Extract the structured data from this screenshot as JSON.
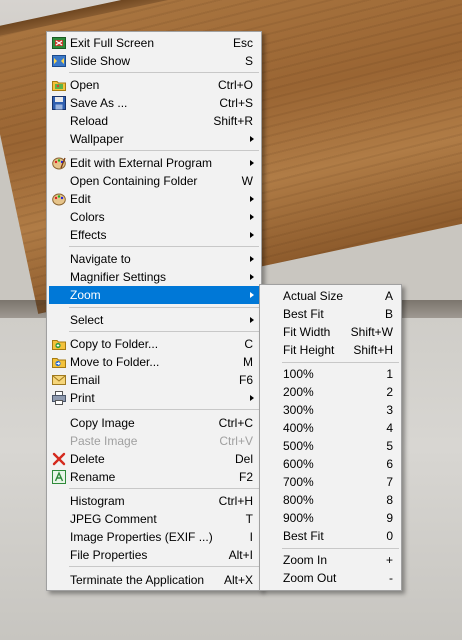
{
  "colors": {
    "menu_bg": "#f2f2f2",
    "highlight": "#0078d7",
    "disabled_text": "#a0a0a0"
  },
  "main_menu": {
    "exit_full_screen": {
      "label": "Exit Full Screen",
      "shortcut": "Esc",
      "icon": "exit-full-screen-icon"
    },
    "slide_show": {
      "label": "Slide Show",
      "shortcut": "S",
      "icon": "slide-show-icon"
    },
    "open": {
      "label": "Open",
      "shortcut": "Ctrl+O",
      "icon": "open-folder-icon"
    },
    "save_as": {
      "label": "Save As ...",
      "shortcut": "Ctrl+S",
      "icon": "save-disk-icon"
    },
    "reload": {
      "label": "Reload",
      "shortcut": "Shift+R"
    },
    "wallpaper": {
      "label": "Wallpaper"
    },
    "edit_external": {
      "label": "Edit with External Program",
      "icon": "palette-icon"
    },
    "open_containing_folder": {
      "label": "Open Containing Folder",
      "shortcut": "W"
    },
    "edit": {
      "label": "Edit",
      "icon": "edit-palette-icon"
    },
    "colors": {
      "label": "Colors"
    },
    "effects": {
      "label": "Effects"
    },
    "navigate_to": {
      "label": "Navigate to"
    },
    "magnifier_settings": {
      "label": "Magnifier Settings"
    },
    "zoom": {
      "label": "Zoom"
    },
    "select": {
      "label": "Select"
    },
    "copy_to_folder": {
      "label": "Copy to Folder...",
      "shortcut": "C",
      "icon": "copy-to-folder-icon"
    },
    "move_to_folder": {
      "label": "Move to Folder...",
      "shortcut": "M",
      "icon": "move-to-folder-icon"
    },
    "email": {
      "label": "Email",
      "shortcut": "F6",
      "icon": "email-icon"
    },
    "print": {
      "label": "Print",
      "icon": "printer-icon"
    },
    "copy_image": {
      "label": "Copy Image",
      "shortcut": "Ctrl+C"
    },
    "paste_image": {
      "label": "Paste Image",
      "shortcut": "Ctrl+V"
    },
    "delete": {
      "label": "Delete",
      "shortcut": "Del",
      "icon": "delete-x-icon"
    },
    "rename": {
      "label": "Rename",
      "shortcut": "F2",
      "icon": "rename-icon"
    },
    "histogram": {
      "label": "Histogram",
      "shortcut": "Ctrl+H"
    },
    "jpeg_comment": {
      "label": "JPEG Comment",
      "shortcut": "T"
    },
    "image_properties": {
      "label": "Image Properties (EXIF ...)",
      "shortcut": "I"
    },
    "file_properties": {
      "label": "File Properties",
      "shortcut": "Alt+I"
    },
    "terminate": {
      "label": "Terminate the Application",
      "shortcut": "Alt+X"
    }
  },
  "zoom_menu": {
    "actual_size": {
      "label": "Actual Size",
      "shortcut": "A"
    },
    "best_fit": {
      "label": "Best Fit",
      "shortcut": "B"
    },
    "fit_width": {
      "label": "Fit Width",
      "shortcut": "Shift+W"
    },
    "fit_height": {
      "label": "Fit Height",
      "shortcut": "Shift+H"
    },
    "z100": {
      "label": "100%",
      "shortcut": "1"
    },
    "z200": {
      "label": "200%",
      "shortcut": "2"
    },
    "z300": {
      "label": "300%",
      "shortcut": "3"
    },
    "z400": {
      "label": "400%",
      "shortcut": "4"
    },
    "z500": {
      "label": "500%",
      "shortcut": "5"
    },
    "z600": {
      "label": "600%",
      "shortcut": "6"
    },
    "z700": {
      "label": "700%",
      "shortcut": "7"
    },
    "z800": {
      "label": "800%",
      "shortcut": "8"
    },
    "z900": {
      "label": "900%",
      "shortcut": "9"
    },
    "best_fit2": {
      "label": "Best Fit",
      "shortcut": "0"
    },
    "zoom_in": {
      "label": "Zoom In",
      "shortcut": "+"
    },
    "zoom_out": {
      "label": "Zoom Out",
      "shortcut": "-"
    }
  }
}
